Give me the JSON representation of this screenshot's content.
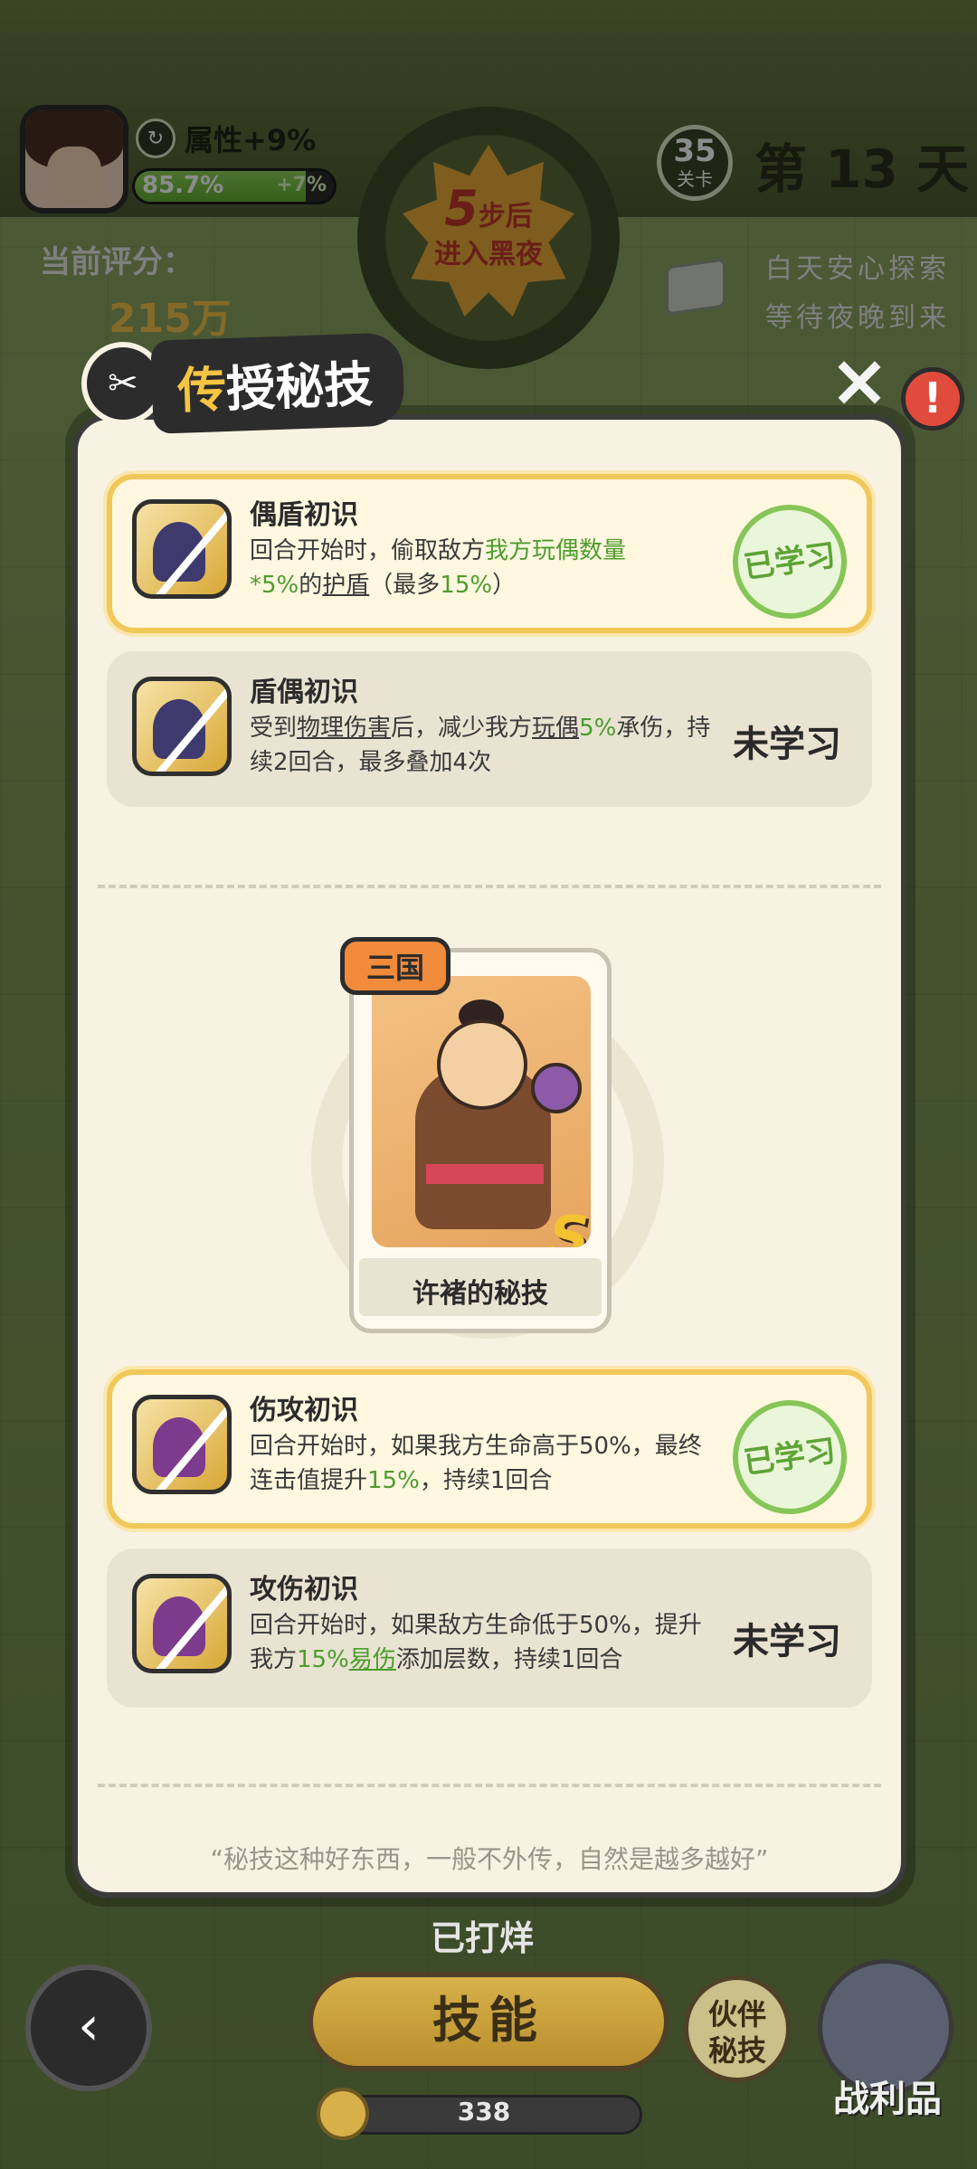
{
  "hud": {
    "attribute": "属性+9%",
    "hp_percent": "85.7%",
    "hp_fraction": 0.857,
    "hp_bonus": "+7%",
    "sun_steps": "5",
    "sun_steps_unit": "步后",
    "sun_text": "进入黑夜",
    "level_number": "35",
    "level_label": "关卡",
    "day_label": "第 13 天",
    "score_label": "当前评分：",
    "score_value": "215万",
    "tip_line1": "白天安心探索",
    "tip_line2": "等待夜晚到来"
  },
  "modal": {
    "title_part1": "传",
    "title_part2": "授秘技",
    "close_icon": "×",
    "alert_icon": "!"
  },
  "skills": [
    {
      "name": "偶盾初识",
      "desc_parts": [
        "回合开始时，偷取敌方",
        "我方玩偶数量",
        "*5%",
        "的",
        "护盾",
        "（最多",
        "15%",
        "）"
      ],
      "status": "已学习"
    },
    {
      "name": "盾偶初识",
      "desc_parts": [
        "受到",
        "物理伤害",
        "后，减少我方",
        "玩偶",
        "5%",
        "承伤，持续2回合，最多叠加4次"
      ],
      "status": "未学习"
    },
    {
      "name": "伤攻初识",
      "desc_parts": [
        "回合开始时，如果我方生命高于50%，最终连击值提升",
        "15%",
        "，持续1回合"
      ],
      "status": "已学习"
    },
    {
      "name": "攻伤初识",
      "desc_parts": [
        "回合开始时，如果敌方生命低于50%，提升我方",
        "15%",
        "易伤",
        "添加层数，持续1回合"
      ],
      "status": "未学习"
    }
  ],
  "hero": {
    "faction": "三国",
    "grade": "S",
    "caption": "许褚的秘技"
  },
  "quote": "“秘技这种好东西，一般不外传，自然是越多越好”",
  "bottom": {
    "stamped_label": "已打烊",
    "back_icon": "‹",
    "skill_button": "技能",
    "partner_line1": "伙伴",
    "partner_line2": "秘技",
    "loot_label": "战利品",
    "coins": "338"
  }
}
